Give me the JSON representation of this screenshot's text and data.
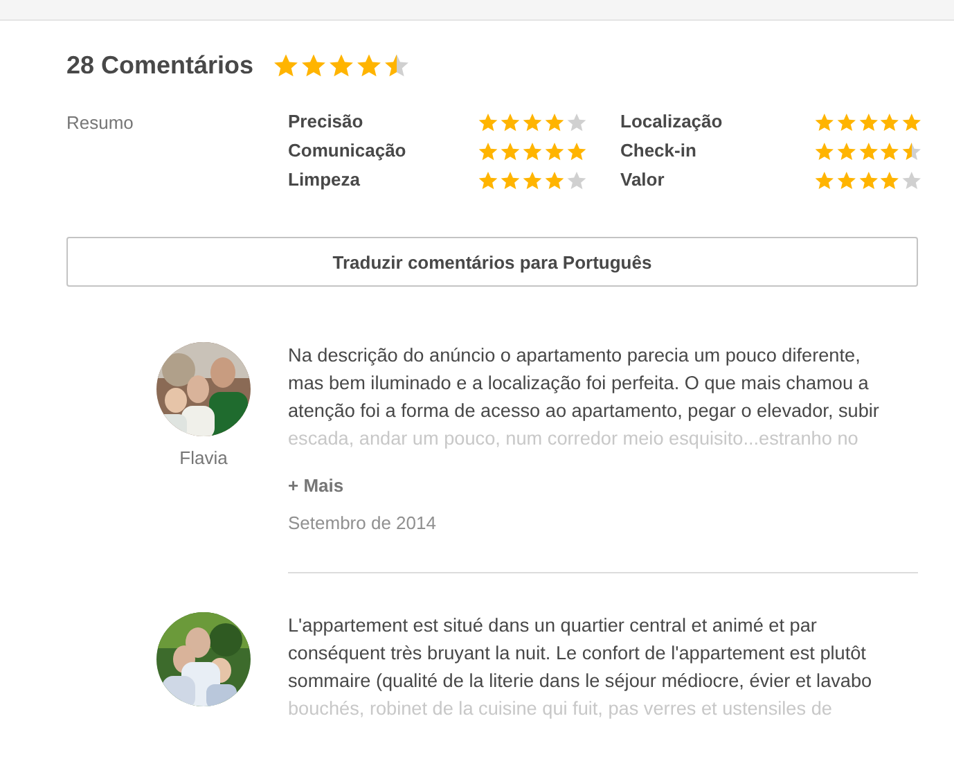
{
  "header": {
    "title": "28 Comentários",
    "stars": 4.5
  },
  "summary": {
    "label": "Resumo",
    "categories": [
      {
        "name": "Precisão",
        "stars": 4
      },
      {
        "name": "Localização",
        "stars": 5
      },
      {
        "name": "Comunicação",
        "stars": 5
      },
      {
        "name": "Check-in",
        "stars": 4.5
      },
      {
        "name": "Limpeza",
        "stars": 4
      },
      {
        "name": "Valor",
        "stars": 4
      }
    ]
  },
  "translate_button": "Traduzir comentários para Português",
  "reviews": [
    {
      "author": "Flavia",
      "text": "Na descrição do anúncio o apartamento parecia um pouco diferente, mas bem iluminado e a localização foi perfeita. O que mais chamou a atenção foi a forma de acesso ao apartamento, pegar o elevador, subir",
      "faded_text": "escada, andar um pouco, num corredor meio esquisito...estranho no",
      "more": "+ Mais",
      "date": "Setembro de 2014"
    },
    {
      "text": "L'appartement est situé dans un quartier central et animé et par conséquent très bruyant la nuit. Le confort de l'appartement est plutôt sommaire (qualité de la literie dans le séjour médiocre, évier et lavabo",
      "faded_text": "bouchés, robinet de la cuisine qui fuit, pas verres et ustensiles de"
    }
  ]
}
